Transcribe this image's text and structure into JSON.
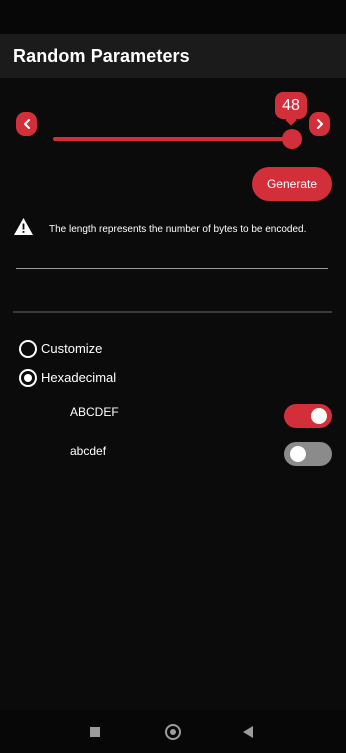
{
  "app_bar": {
    "title": "Random Parameters"
  },
  "slider": {
    "value": "48",
    "fraction": 0.95,
    "decrement_icon": "chevron-left-icon",
    "increment_icon": "chevron-right-icon"
  },
  "generate_label": "Generate",
  "hint": {
    "icon": "warning-icon",
    "text": "The length represents the number of bytes to be encoded."
  },
  "encoding": {
    "options": [
      {
        "label": "Customize",
        "selected": false
      },
      {
        "label": "Hexadecimal",
        "selected": true
      }
    ]
  },
  "case_options": [
    {
      "label": "ABCDEF",
      "enabled": true
    },
    {
      "label": "abcdef",
      "enabled": false
    }
  ],
  "colors": {
    "accent": "#d32f3a",
    "background": "#0b0b0b",
    "app_bar": "#1b1b1b",
    "switch_off": "#8b8b8b"
  },
  "nav_bar": {
    "icons": [
      "recents-square-icon",
      "home-circle-icon",
      "back-triangle-icon"
    ]
  }
}
